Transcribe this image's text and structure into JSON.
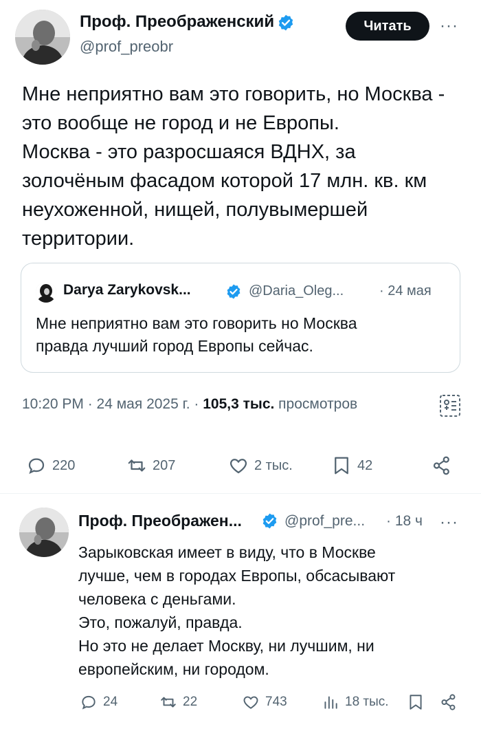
{
  "tweet": {
    "author_name": "Проф. Преображенский",
    "author_handle": "@prof_preobr",
    "read_button": "Читать",
    "more": "···",
    "text": "Мне неприятно вам это говорить, но Москва -\nэто вообще не город и не Европы.\nМосква - это разросшаяся ВДНХ, за\nзолочёным фасадом которой 17 млн. кв. км\nнеухоженной, нищей, полувымершей\nтерритории.",
    "quote": {
      "author_name": "Darya Zarykovsk...",
      "author_handle": "@Daria_Oleg...",
      "date": "· 24 мая",
      "text": "Мне неприятно вам это говорить но Москва\nправда лучший город Европы сейчас."
    },
    "meta": {
      "time": "10:20 PM · 24 мая 2025 г. · ",
      "views_count": "105,3 тыс.",
      "views_label": " просмотров"
    },
    "actions": {
      "replies": "220",
      "retweets": "207",
      "likes": "2 тыс.",
      "bookmarks": "42"
    }
  },
  "reply": {
    "author_name": "Проф. Преображен...",
    "author_handle": "@prof_pre...",
    "time": "· 18 ч",
    "more": "···",
    "text": "Зарыковская имеет в виду, что в Москве\nлучше, чем в городах Европы, обсасывают\nчеловека с деньгами.\nЭто, пожалуй, правда.\nНо это не делает Москву, ни лучшим, ни\nевропейским, ни городом.",
    "actions": {
      "replies": "24",
      "retweets": "22",
      "likes": "743",
      "views": "18 тыс."
    }
  },
  "colors": {
    "verified": "#1d9bf0",
    "text": "#0f1419",
    "secondary": "#536471"
  }
}
